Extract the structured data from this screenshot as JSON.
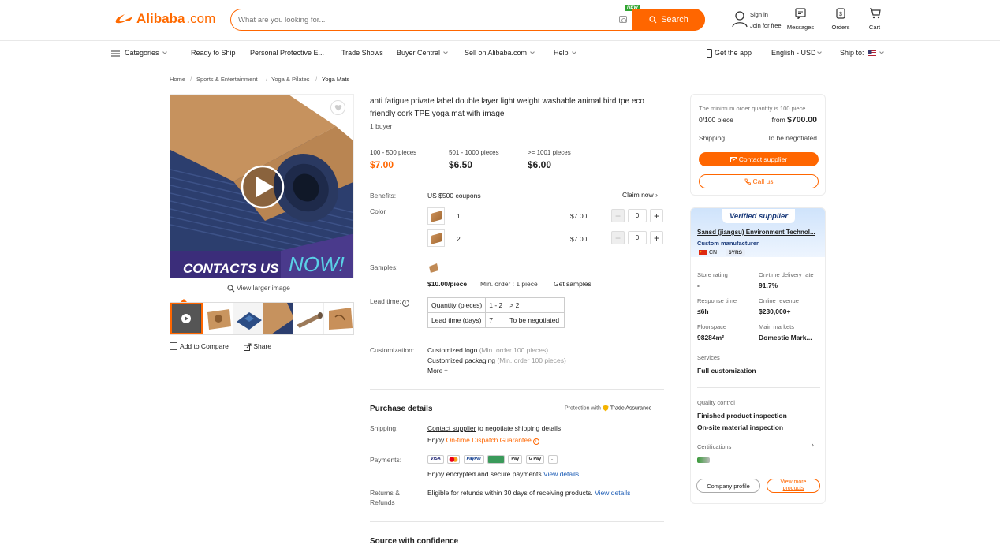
{
  "header": {
    "logo": "Alibaba",
    "logo_suffix": ".com",
    "search_placeholder": "What are you looking for...",
    "new_badge": "NEW",
    "search_button": "Search",
    "sign_in": "Sign in",
    "join": "Join for free",
    "messages": "Messages",
    "orders": "Orders",
    "cart": "Cart"
  },
  "nav": {
    "categories": "Categories",
    "items": [
      "Ready to Ship",
      "Personal Protective E...",
      "Trade Shows",
      "Buyer Central",
      "Sell on Alibaba.com",
      "Help"
    ],
    "get_app": "Get the app",
    "language": "English - USD",
    "ship_to": "Ship to:"
  },
  "breadcrumb": [
    "Home",
    "Sports & Entertainment",
    "Yoga & Pilates",
    "Yoga Mats"
  ],
  "gallery": {
    "banner_text": "CONTACTS US",
    "banner_now": "NOW!",
    "view_larger": "View larger image",
    "add_compare": "Add to Compare",
    "share": "Share"
  },
  "product": {
    "title": "anti fatigue private label double layer light weight washable animal bird tpe eco friendly cork TPE yoga mat with image",
    "buyers": "1 buyer",
    "tiers": [
      {
        "qty": "100 - 500 pieces",
        "price": "$7.00"
      },
      {
        "qty": "501 - 1000 pieces",
        "price": "$6.50"
      },
      {
        "qty": ">= 1001 pieces",
        "price": "$6.00"
      }
    ],
    "benefits_label": "Benefits:",
    "benefits_value": "US $500 coupons",
    "claim_now": "Claim now",
    "color_label": "Color",
    "colors": [
      {
        "name": "1",
        "price": "$7.00",
        "qty": "0"
      },
      {
        "name": "2",
        "price": "$7.00",
        "qty": "0"
      }
    ],
    "samples_label": "Samples:",
    "sample_price": "$10.00/piece",
    "sample_min": "Min. order : 1 piece",
    "get_samples": "Get samples",
    "lead_label": "Lead time:",
    "lead_table": {
      "row1": [
        "Quantity (pieces)",
        "1 - 2",
        "> 2"
      ],
      "row2": [
        "Lead time (days)",
        "7",
        "To be negotiated"
      ]
    },
    "custom_label": "Customization:",
    "custom_logo": "Customized logo",
    "custom_logo_min": "(Min. order 100 pieces)",
    "custom_pack": "Customized packaging",
    "custom_pack_min": "(Min. order 100 pieces)",
    "more": "More"
  },
  "purchase": {
    "heading": "Purchase details",
    "protection": "Protection with",
    "trade_assurance": "Trade Assurance",
    "shipping_label": "Shipping:",
    "contact_supplier": "Contact supplier",
    "shipping_text": "to negotiate shipping details",
    "enjoy": "Enjoy",
    "dispatch": "On-time Dispatch Guarantee",
    "payments_label": "Payments:",
    "pay_methods": [
      "VISA",
      "MC",
      "PayPal",
      "Pay",
      "Apple Pay",
      "G Pay",
      "..."
    ],
    "secure_text": "Enjoy encrypted and secure payments",
    "view_details": "View details",
    "returns_label_1": "Returns &",
    "returns_label_2": "Refunds",
    "refund_text": "Eligible for refunds within 30 days of receiving products.",
    "source_heading": "Source with confidence"
  },
  "order_panel": {
    "moq_note": "The minimum order quantity is 100 piece",
    "progress": "0/100 piece",
    "from": "from",
    "from_price": "$700.00",
    "shipping_label": "Shipping",
    "shipping_value": "To be negotiated",
    "contact_button": "Contact supplier",
    "call_button": "Call us"
  },
  "supplier": {
    "verified": "Verified supplier",
    "name": "Sansd (jiangsu) Environment Technol...",
    "type": "Custom manufacturer",
    "country": "CN",
    "years": "6YRS",
    "store_rating_label": "Store rating",
    "store_rating": "-",
    "ontime_label": "On-time delivery rate",
    "ontime": "91.7%",
    "response_label": "Response time",
    "response": "≤6h",
    "revenue_label": "Online revenue",
    "revenue": "$230,000+",
    "floor_label": "Floorspace",
    "floor": "98284m²",
    "markets_label": "Main markets",
    "markets": "Domestic Mark...",
    "services_label": "Services",
    "services": "Full customization",
    "qc_label": "Quality control",
    "qc_1": "Finished product inspection",
    "qc_2": "On-site material inspection",
    "certs_label": "Certifications",
    "company_profile": "Company profile",
    "more_products_1": "View more",
    "more_products_2": "products"
  }
}
